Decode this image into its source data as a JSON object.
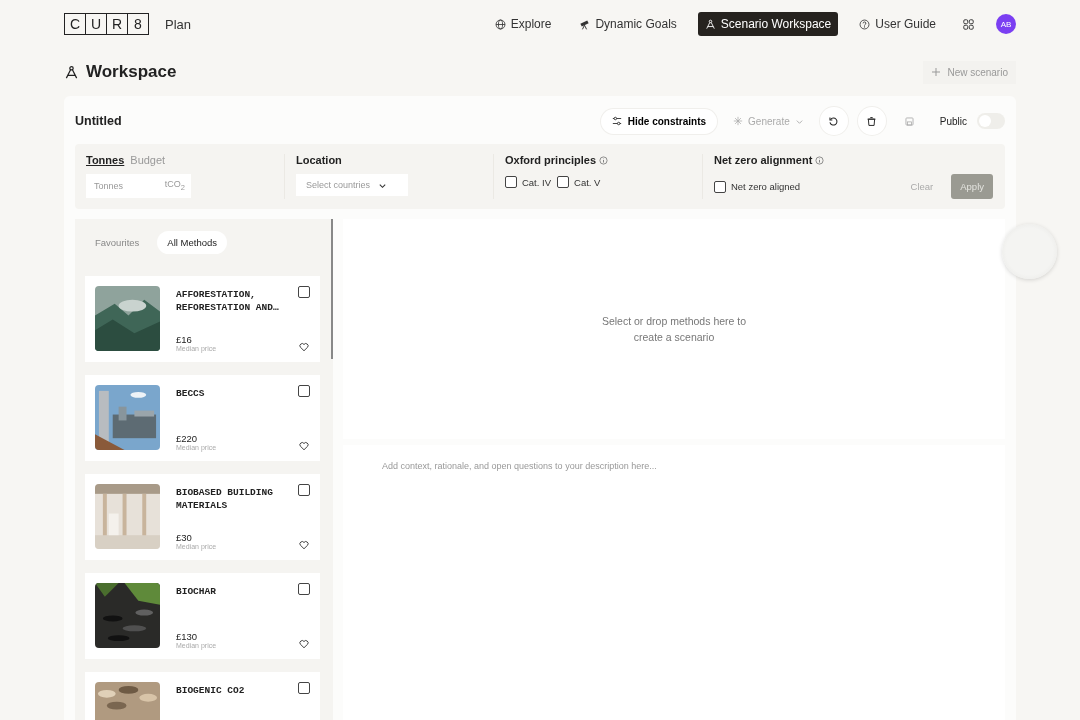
{
  "header": {
    "logo_letters": [
      "C",
      "U",
      "R",
      "8"
    ],
    "product": "Plan",
    "nav": [
      {
        "label": "Explore",
        "selected": false
      },
      {
        "label": "Dynamic Goals",
        "selected": false
      },
      {
        "label": "Scenario Workspace",
        "selected": true
      },
      {
        "label": "User Guide",
        "selected": false
      }
    ],
    "avatar": "AB"
  },
  "page": {
    "title": "Workspace",
    "new_button": "New scenario"
  },
  "scenario": {
    "name": "Untitled",
    "hide_constraints": "Hide constraints",
    "generate": {
      "label": "Generate",
      "disabled": true
    },
    "public": {
      "label": "Public",
      "on": false
    }
  },
  "constraints": {
    "budget_tabs": [
      {
        "label": "Tonnes",
        "selected": true
      },
      {
        "label": "Budget",
        "selected": false
      }
    ],
    "tonnes_field": {
      "placeholder": "Tonnes",
      "unit": "tCO$_{2}$"
    },
    "location": {
      "label": "Location",
      "placeholder": "Select countries"
    },
    "oxford": {
      "label": "Oxford principles",
      "options": [
        {
          "label": "Cat. IV",
          "checked": false
        },
        {
          "label": "Cat. V",
          "checked": false
        }
      ]
    },
    "net_zero": {
      "label": "Net zero alignment",
      "options": [
        {
          "label": "Net zero aligned",
          "checked": false
        }
      ]
    },
    "clear": "Clear",
    "apply": {
      "label": "Apply",
      "disabled": true
    }
  },
  "method_tabs": [
    {
      "label": "Favourites",
      "selected": false
    },
    {
      "label": "All Methods",
      "selected": true
    }
  ],
  "methods": [
    {
      "name": "AFFORESTATION, REFORESTATION AND…",
      "price": "£16",
      "caption": "Median price",
      "checked": false,
      "favourite": false
    },
    {
      "name": "BECCS",
      "price": "£220",
      "caption": "Median price",
      "checked": false,
      "favourite": false
    },
    {
      "name": "BIOBASED BUILDING MATERIALS",
      "price": "£30",
      "caption": "Median price",
      "checked": false,
      "favourite": false
    },
    {
      "name": "BIOCHAR",
      "price": "£130",
      "caption": "Median price",
      "checked": false,
      "favourite": false
    },
    {
      "name": "BIOGENIC CO2",
      "checked": false
    }
  ],
  "canvas": {
    "empty_text": "Select or drop methods here to create a scenario",
    "description_placeholder": "Add context, rationale, and open questions to your description here..."
  }
}
